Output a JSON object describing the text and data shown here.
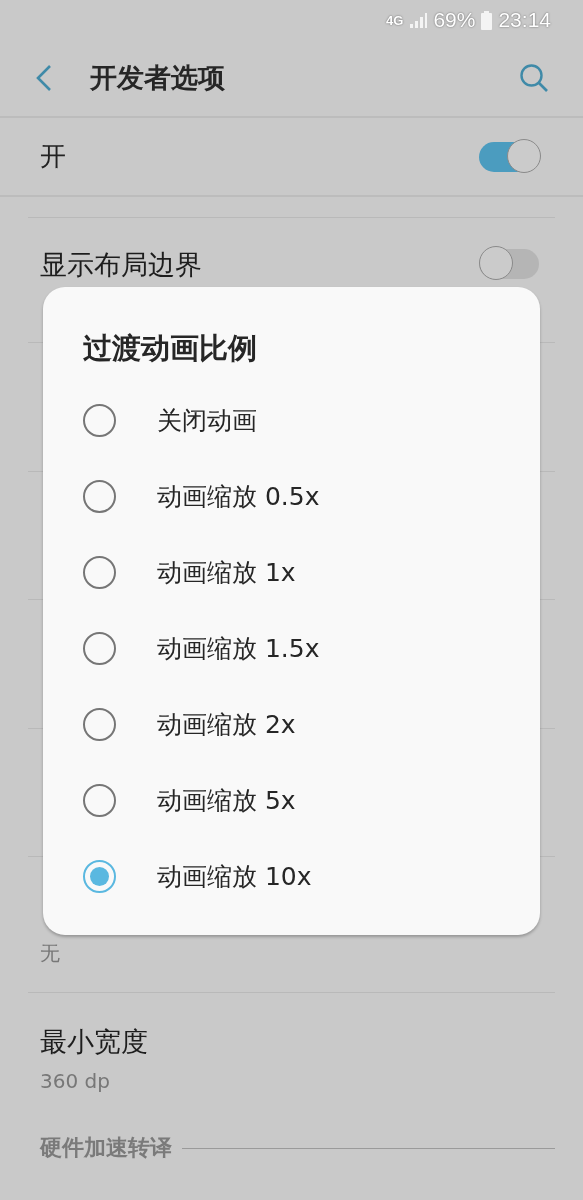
{
  "status_bar": {
    "network": "4G",
    "battery": "69%",
    "time": "23:14"
  },
  "header": {
    "title": "开发者选项"
  },
  "master_switch": {
    "label": "开",
    "on": true
  },
  "settings": [
    {
      "kind": "toggle",
      "title": "显示布局边界",
      "on": false
    },
    {
      "kind": "covered"
    },
    {
      "kind": "covered"
    },
    {
      "kind": "covered"
    },
    {
      "kind": "covered"
    },
    {
      "kind": "text",
      "subtitle": "无"
    },
    {
      "kind": "text",
      "title": "最小宽度",
      "subtitle": "360 dp"
    }
  ],
  "category": {
    "title": "硬件加速转译"
  },
  "dialog": {
    "title": "过渡动画比例",
    "options": [
      {
        "label": "关闭动画",
        "selected": false
      },
      {
        "label": "动画缩放 0.5x",
        "selected": false
      },
      {
        "label": "动画缩放 1x",
        "selected": false
      },
      {
        "label": "动画缩放 1.5x",
        "selected": false
      },
      {
        "label": "动画缩放 2x",
        "selected": false
      },
      {
        "label": "动画缩放 5x",
        "selected": false
      },
      {
        "label": "动画缩放 10x",
        "selected": true
      }
    ]
  }
}
